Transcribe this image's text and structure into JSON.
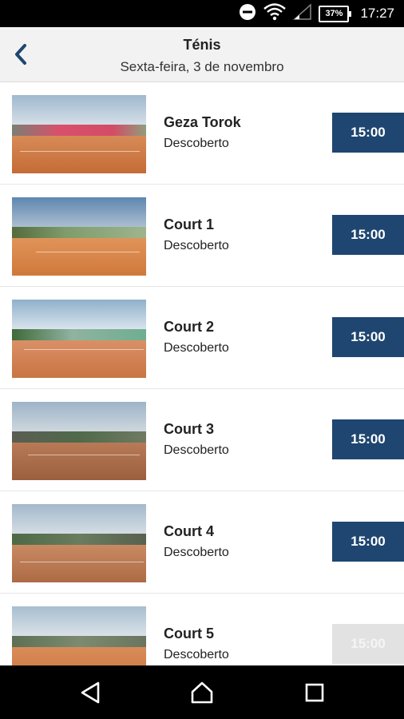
{
  "status_bar": {
    "battery": "37%",
    "time": "17:27",
    "icons": [
      "do-not-disturb-icon",
      "wifi-icon",
      "signal-icon",
      "battery-icon"
    ]
  },
  "header": {
    "title": "Ténis",
    "subtitle": "Sexta-feira, 3 de novembro",
    "back_icon": "chevron-left-icon"
  },
  "courts": [
    {
      "name": "Geza Torok",
      "type": "Descoberto",
      "time": "15:00",
      "available": true
    },
    {
      "name": "Court 1",
      "type": "Descoberto",
      "time": "15:00",
      "available": true
    },
    {
      "name": "Court 2",
      "type": "Descoberto",
      "time": "15:00",
      "available": true
    },
    {
      "name": "Court 3",
      "type": "Descoberto",
      "time": "15:00",
      "available": true
    },
    {
      "name": "Court 4",
      "type": "Descoberto",
      "time": "15:00",
      "available": true
    },
    {
      "name": "Court 5",
      "type": "Descoberto",
      "time": "15:00",
      "available": false
    }
  ],
  "nav_bar": {
    "icons": [
      "back-triangle-icon",
      "home-icon",
      "recents-square-icon"
    ]
  },
  "colors": {
    "accent": "#1e4670",
    "disabled": "#e2e2e2",
    "header_bg": "#f2f2f2"
  }
}
